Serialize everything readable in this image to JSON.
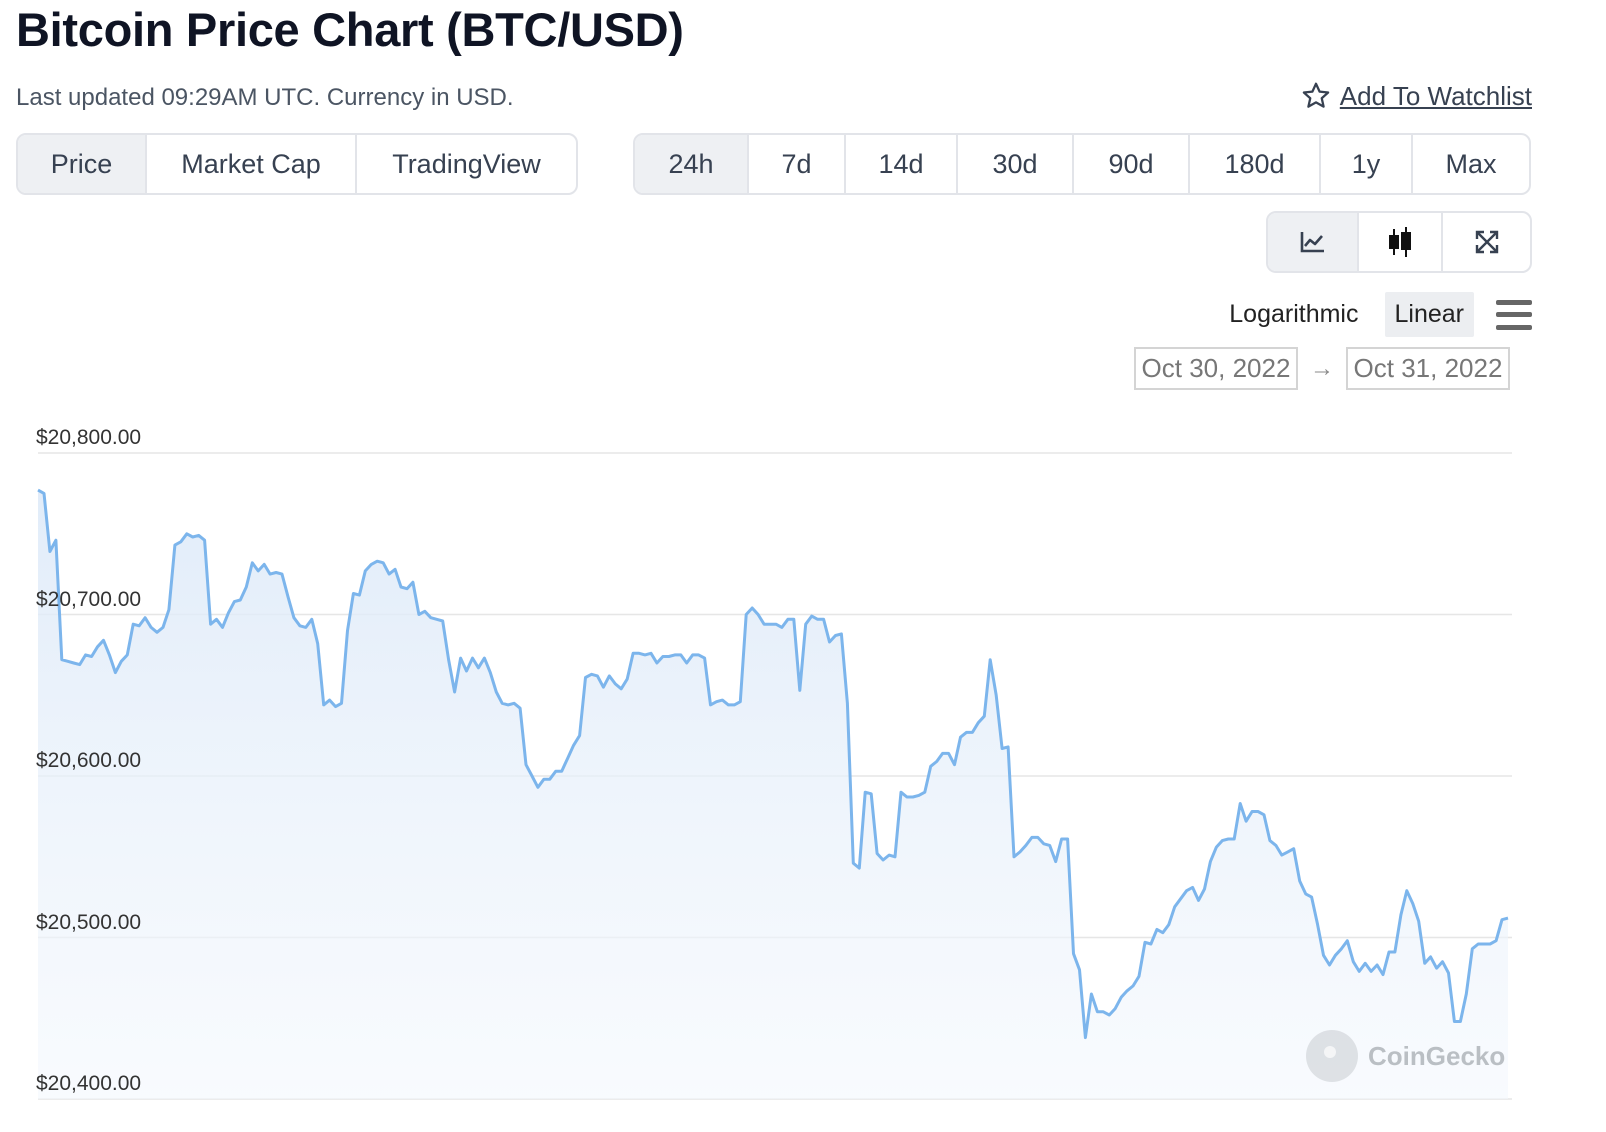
{
  "header": {
    "title": "Bitcoin Price Chart (BTC/USD)",
    "updated": "Last updated 09:29AM UTC. Currency in USD.",
    "watchlist_label": "Add To Watchlist"
  },
  "chart_type_tabs": [
    {
      "label": "Price",
      "active": true
    },
    {
      "label": "Market Cap",
      "active": false
    },
    {
      "label": "TradingView",
      "active": false
    }
  ],
  "range_tabs": [
    {
      "label": "24h",
      "active": true
    },
    {
      "label": "7d",
      "active": false
    },
    {
      "label": "14d",
      "active": false
    },
    {
      "label": "30d",
      "active": false
    },
    {
      "label": "90d",
      "active": false
    },
    {
      "label": "180d",
      "active": false
    },
    {
      "label": "1y",
      "active": false
    },
    {
      "label": "Max",
      "active": false
    }
  ],
  "style_buttons": [
    {
      "icon": "line-chart-icon",
      "active": true
    },
    {
      "icon": "candlestick-icon",
      "active": false
    },
    {
      "icon": "expand-icon",
      "active": false
    }
  ],
  "scale": {
    "options": [
      "Logarithmic",
      "Linear"
    ],
    "active": "Linear"
  },
  "date_range": {
    "from": "Oct 30, 2022",
    "to": "Oct 31, 2022"
  },
  "watermark": "CoinGecko",
  "colors": {
    "line": "#7cb5ec",
    "grid": "#e6e6e6",
    "text": "#333333"
  },
  "chart_data": {
    "type": "area",
    "ylabel": "",
    "xlabel": "",
    "ylim": [
      20400,
      20800
    ],
    "yticks": [
      20800,
      20700,
      20600,
      20500,
      20400
    ],
    "ytick_labels": [
      "$20,800.00",
      "$20,700.00",
      "$20,600.00",
      "$20,500.00",
      "$20,400.00"
    ],
    "grid": true,
    "series": [
      {
        "values": [
          20777,
          20775,
          20739,
          20746,
          20672,
          20671,
          20670,
          20669,
          20675,
          20674,
          20680,
          20684,
          20675,
          20664,
          20671,
          20675,
          20694,
          20693,
          20698,
          20692,
          20689,
          20692,
          20703,
          20743,
          20745,
          20750,
          20748,
          20749,
          20746,
          20694,
          20697,
          20692,
          20701,
          20708,
          20709,
          20717,
          20732,
          20727,
          20731,
          20725,
          20726,
          20725,
          20711,
          20698,
          20693,
          20692,
          20697,
          20682,
          20644,
          20647,
          20643,
          20645,
          20690,
          20713,
          20712,
          20727,
          20731,
          20733,
          20732,
          20725,
          20728,
          20717,
          20716,
          20720,
          20700,
          20702,
          20698,
          20697,
          20696,
          20672,
          20652,
          20673,
          20665,
          20673,
          20667,
          20673,
          20664,
          20652,
          20645,
          20644,
          20645,
          20642,
          20607,
          20600,
          20593,
          20598,
          20598,
          20603,
          20603,
          20611,
          20619,
          20625,
          20661,
          20663,
          20662,
          20655,
          20662,
          20657,
          20654,
          20660,
          20676,
          20676,
          20675,
          20676,
          20670,
          20674,
          20674,
          20675,
          20675,
          20670,
          20675,
          20675,
          20673,
          20644,
          20646,
          20647,
          20644,
          20644,
          20646,
          20700,
          20704,
          20700,
          20694,
          20694,
          20694,
          20692,
          20697,
          20697,
          20653,
          20694,
          20699,
          20697,
          20697,
          20683,
          20687,
          20688,
          20645,
          20546,
          20543,
          20590,
          20589,
          20552,
          20548,
          20551,
          20550,
          20590,
          20587,
          20587,
          20588,
          20590,
          20606,
          20609,
          20614,
          20614,
          20607,
          20624,
          20627,
          20627,
          20633,
          20637,
          20672,
          20650,
          20617,
          20618,
          20550,
          20553,
          20557,
          20562,
          20562,
          20558,
          20557,
          20547,
          20561,
          20561,
          20490,
          20480,
          20438,
          20465,
          20454,
          20454,
          20452,
          20456,
          20463,
          20467,
          20470,
          20476,
          20497,
          20496,
          20505,
          20503,
          20508,
          20519,
          20524,
          20529,
          20531,
          20523,
          20530,
          20547,
          20556,
          20560,
          20561,
          20561,
          20583,
          20572,
          20578,
          20578,
          20576,
          20560,
          20557,
          20551,
          20553,
          20555,
          20535,
          20527,
          20525,
          20508,
          20489,
          20483,
          20489,
          20493,
          20498,
          20485,
          20479,
          20484,
          20479,
          20483,
          20477,
          20491,
          20491,
          20514,
          20529,
          20521,
          20510,
          20484,
          20488,
          20481,
          20485,
          20478,
          20448,
          20448,
          20465,
          20493,
          20496,
          20496,
          20496,
          20498,
          20511,
          20512
        ]
      }
    ]
  }
}
